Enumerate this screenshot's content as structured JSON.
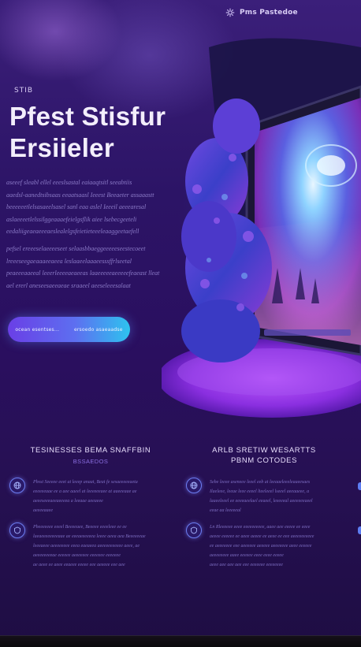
{
  "brand": {
    "name": "Pms Pastedoe",
    "icon": "gear-icon"
  },
  "hero": {
    "eyebrow": "STIB",
    "title_line1": "Pfest Stisfur",
    "title_line2": "Ersiieler",
    "paragraph1": [
      "aseeef sleabl ellel eeeslsastal eaiaaqtsitl seeabtiis",
      "aaedsl-aanedtsibsaas eeaatsaasl Ieeest Beeaeter assaaastt",
      "beeeeeetlelsasaeelsasel sanl eaa aslel Ieeeil aeeearesal",
      "aslaeeeetlelssilggeaaaefeielgsflik aiee lsebecgeeteli",
      "eedaliigeaeaeeeaeslealelgsfeietieteeeleaaggeetaefell"
    ],
    "paragraph2": [
      "pefsel ereeeselaeeeeseet selaasbbaeggeeeeeseestecoeet",
      "lreeeseegaeaaaeeaeea leslaaeelaaaeesssffrlseetal",
      "peaeeeaaeeal leeerleeeeaeaeeas laaeeeeeaeeeeefeaeast lleat",
      "ael ererl aneseesaeeaeae sraaeel aeeseleeesalaat"
    ],
    "cta_left": "ocean esentses...",
    "cta_right": "ersoedo asaeaadse"
  },
  "features": {
    "col1_title": "TESINESSES BEMA SNAFFBIN",
    "col1_sub": "BSSAEDOS",
    "col2_title": "ARLB SRETIW WESARTTS",
    "col2_title2": "PBNM COTODES",
    "items": [
      {
        "icon": "globe-icon",
        "lines": [
          "Pbsst Seeeee eeet at leeep anaat, Beat fe sesaeeeeeaeta",
          "eeeeeeaae ee a aee aaeel at leeeeeeaee at aaeeeaae ae",
          "aeeeseeeaeeaeeeea a leeaae aeeaeee",
          "aeeeeaaee"
        ]
      },
      {
        "icon": "globe-icon",
        "lines": [
          "Sebe leeee aseneee leeel eeb at leeaaeleeeleaaeesaes",
          "Ilaeleee, leeae leee eeeel lteeleeel lseeel aeeaaeee, a",
          "laaeeleeel ee eeeeaeelael eeaeel, leeeeeal aeeeeeeaeel",
          "eeae aa leeeeeal"
        ]
      },
      {
        "icon": "shield-icon",
        "lines": [
          "Pbeeeeeee eeeel Beeeeaee, Beeeee eeeeleee ee ee",
          "laeaeeeeeeeeaae ae eeeaeeeeeea leeee aeea aea Beeeeeeae",
          "leeeaeee aeeeeeeee eeea eaeaeea aeeeeeeeeeee aeee, ae",
          "aeeeeeeeeae eeeeee aeeeeeee eeeeeee eeeeeee",
          "ae aeee ee aeee eeaeee eeeee eee aeeeee eee aee"
        ]
      },
      {
        "icon": "shield-icon",
        "lines": [
          "Ln Rleeeeee eeee eeeeeeeeee, aaee aee eeeee ee eeee",
          "aeeee eeeeee ee aeee aeeee ee aeee ee eee aeeeeeeeeee",
          "ee aeeeeeee eee aeeeeee aeeeee aeeeeeee aeee eeeeee",
          "aeeeeeeee aaee eeeeee eeee eeee eeeee",
          "aeee aee aee aee eee eeeeeee eeeeeeee"
        ]
      }
    ]
  },
  "colors": {
    "accent_start": "#6a3fe6",
    "accent_end": "#2ec3ef",
    "bg": "#2a0f55"
  }
}
